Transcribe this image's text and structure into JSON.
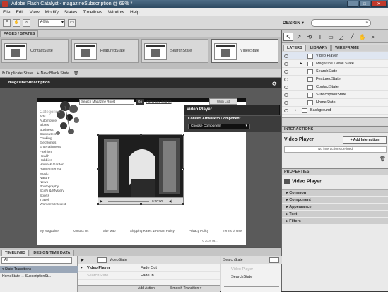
{
  "window": {
    "title": "Adobe Flash Catalyst - magazineSubscription @ 69% *",
    "minimize": "–",
    "maximize": "□",
    "close": "✕"
  },
  "menu": [
    "File",
    "Edit",
    "View",
    "Modify",
    "States",
    "Timelines",
    "Window",
    "Help"
  ],
  "toolbar": {
    "zoom": "69%",
    "workspace": "DESIGN",
    "search_icon": "search-icon"
  },
  "pages_panel": {
    "title": "PAGES / STATES",
    "states": [
      "ContactState",
      "FeaturedState",
      "SearchState",
      "VideoState"
    ],
    "selected": "VideoState",
    "duplicate_label": "Duplicate State",
    "new_blank_label": "New Blank State"
  },
  "artboard": {
    "title": "magazineSubscription",
    "search_placeholder": "Search Magazine Roost",
    "go": "Go",
    "advanced": "Advanced Search",
    "wish_list": "Wish List",
    "categories_title": "Categories",
    "categories": [
      "Arts",
      "Automotive",
      "Bibles",
      "Business",
      "Computers",
      "Cooking",
      "Electronics",
      "Entertainment",
      "Fashion",
      "Health",
      "Hobbies",
      "Home & Garden",
      "Home Interest",
      "Music",
      "Nature",
      "News",
      "Photography",
      "Sci-Fi & Mystery",
      "Sports",
      "Travel",
      "Women's Interest"
    ],
    "video_time": "0:00:00",
    "footer_links": [
      "My Magazine",
      "Contact Us",
      "Site Map",
      "Shipping Rates & Return Policy",
      "Privacy Policy",
      "Terms of Use"
    ],
    "copyright": "© 2009 Mi..."
  },
  "hud": {
    "title": "Video Player",
    "convert_label": "Convert Artwork to Component",
    "choose_label": "Choose Component"
  },
  "right_panel": {
    "tabs": [
      "LAYERS",
      "LIBRARY",
      "WIREFRAME COMPONENTS"
    ],
    "layers": [
      {
        "name": "Video Player",
        "indent": 1,
        "selected": true
      },
      {
        "name": "Magazine Detail State",
        "indent": 1,
        "selected": false,
        "folder": true
      },
      {
        "name": "SearchState",
        "indent": 2,
        "selected": false
      },
      {
        "name": "FeaturedState",
        "indent": 2,
        "selected": false
      },
      {
        "name": "ContactState",
        "indent": 2,
        "selected": false
      },
      {
        "name": "SubscriptionState",
        "indent": 2,
        "selected": false
      },
      {
        "name": "HomeState",
        "indent": 2,
        "selected": false
      },
      {
        "name": "Background",
        "indent": 1,
        "selected": false,
        "folder": true
      }
    ],
    "interactions_title": "INTERACTIONS",
    "interactions_component": "Video Player",
    "add_interaction": "Add Interaction",
    "no_interactions": "No interactions defined",
    "properties_title": "PROPERTIES",
    "properties_component": "Video Player",
    "sections": [
      "Common",
      "Component",
      "Appearance",
      "Text",
      "Filters"
    ]
  },
  "timelines": {
    "tabs": [
      "TIMELINES",
      "DESIGN-TIME DATA"
    ],
    "filter": "All",
    "transitions_header": "State Transitions",
    "transition_from": "HomeState",
    "transition_to": "SubscriptionSt...",
    "left_state": "VideoState",
    "right_state": "SearchState",
    "track_label": "Video Player",
    "track_label_faded": "SearchState",
    "actions": [
      "Fade Out",
      "Fade In"
    ],
    "add_action": "Add Action",
    "smooth": "Smooth Transition",
    "right_faded": "Video Player",
    "right_item": "SearchState"
  },
  "colors": {
    "title_bar": "#2a465e",
    "selection": "#dfe6f1",
    "hud": "#2a2a2a"
  }
}
